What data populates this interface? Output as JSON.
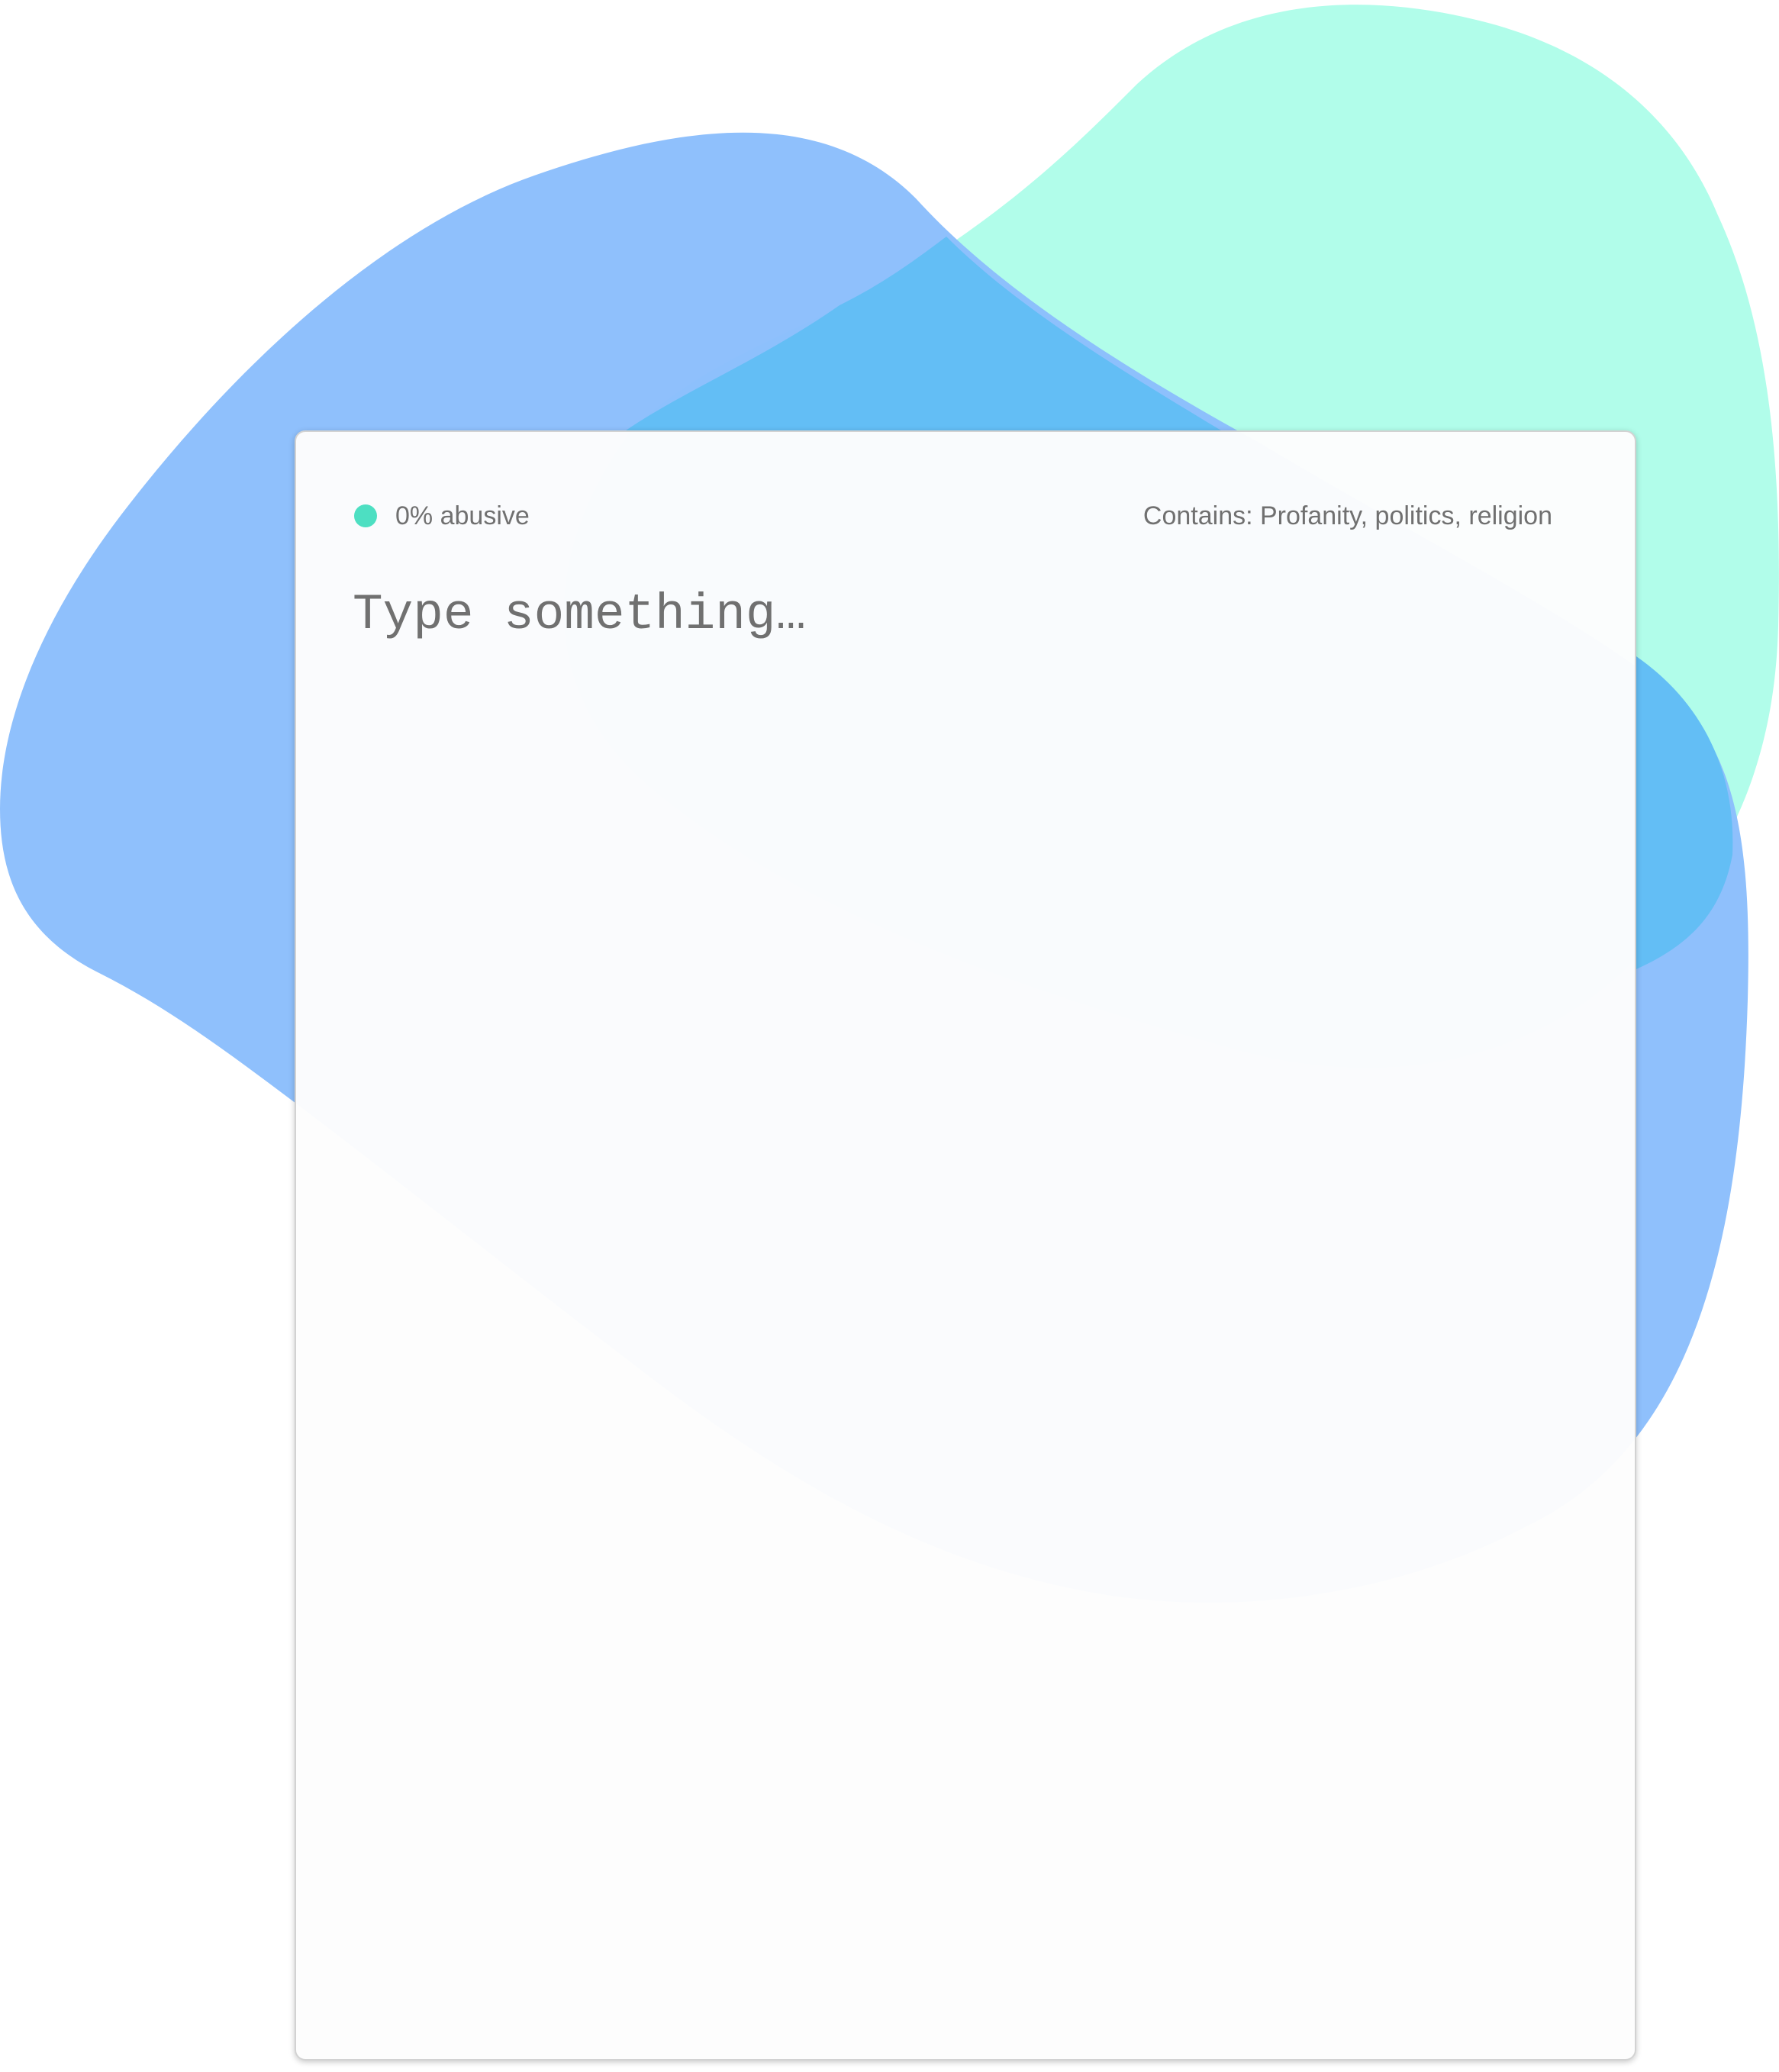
{
  "status": {
    "label": "0% abusive",
    "dot_color": "#4ddfc2",
    "dot_icon": "status-dot-icon"
  },
  "categories": {
    "label": "Contains: Profanity, politics, religion"
  },
  "editor": {
    "value": "",
    "placeholder": "Type something…"
  },
  "colors": {
    "blob_blue": "#8bbefc",
    "blob_mint": "#b1fdea",
    "blob_overlap": "#63bef5",
    "text": "#707070"
  }
}
